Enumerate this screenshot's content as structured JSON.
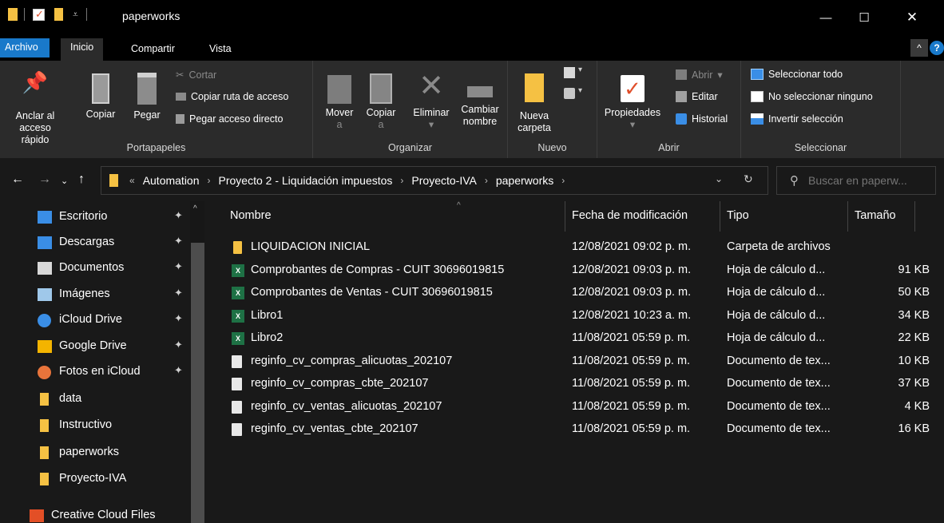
{
  "window": {
    "title": "paperworks",
    "minimize": "—",
    "maximize": "☐",
    "close": "✕"
  },
  "ribbon_tabs": [
    "Archivo",
    "Inicio",
    "Compartir",
    "Vista"
  ],
  "ribbon": {
    "portapapeles": {
      "name": "Portapapeles",
      "pin_line1": "Anclar al",
      "pin_line2": "acceso rápido",
      "copy": "Copiar",
      "paste": "Pegar",
      "cut": "Cortar",
      "copy_path": "Copiar ruta de acceso",
      "paste_shortcut": "Pegar acceso directo"
    },
    "organizar": {
      "name": "Organizar",
      "move_line1": "Mover",
      "move_line2": "a",
      "copy_line1": "Copiar",
      "copy_line2": "a",
      "delete": "Eliminar",
      "rename_line1": "Cambiar",
      "rename_line2": "nombre"
    },
    "nuevo": {
      "name": "Nuevo",
      "new_folder_line1": "Nueva",
      "new_folder_line2": "carpeta"
    },
    "abrir": {
      "name": "Abrir",
      "properties": "Propiedades",
      "open": "Abrir",
      "edit": "Editar",
      "history": "Historial"
    },
    "seleccionar": {
      "name": "Seleccionar",
      "select_all": "Seleccionar todo",
      "select_none": "No seleccionar ninguno",
      "invert": "Invertir selección"
    }
  },
  "address": {
    "overflow": "«",
    "crumbs": [
      "Automation",
      "Proyecto 2 - Liquidación impuestos",
      "Proyecto-IVA",
      "paperworks"
    ],
    "search_placeholder": "Buscar en paperw..."
  },
  "nav_items": [
    {
      "label": "Escritorio",
      "icon": "desktop-icon",
      "color": "#3a8ee6",
      "pinned": true
    },
    {
      "label": "Descargas",
      "icon": "download-icon",
      "color": "#3a8ee6",
      "pinned": true
    },
    {
      "label": "Documentos",
      "icon": "document-icon",
      "color": "#d8d8d8",
      "pinned": true
    },
    {
      "label": "Imágenes",
      "icon": "image-icon",
      "color": "#9fc8ea",
      "pinned": true
    },
    {
      "label": "iCloud Drive",
      "icon": "icloud-icon",
      "color": "#3a8ee6",
      "pinned": true
    },
    {
      "label": "Google Drive",
      "icon": "google-drive-icon",
      "color": "#f4b400",
      "pinned": true
    },
    {
      "label": "Fotos en iCloud",
      "icon": "photos-icon",
      "color": "#e8743b",
      "pinned": true
    },
    {
      "label": "data",
      "icon": "folder-icon",
      "color": "#f5c143",
      "pinned": false
    },
    {
      "label": "Instructivo",
      "icon": "folder-icon",
      "color": "#f5c143",
      "pinned": false
    },
    {
      "label": "paperworks",
      "icon": "folder-icon",
      "color": "#f5c143",
      "pinned": false
    },
    {
      "label": "Proyecto-IVA",
      "icon": "folder-icon",
      "color": "#f5c143",
      "pinned": false
    },
    {
      "label": "Creative Cloud Files",
      "icon": "creative-cloud-icon",
      "color": "#e34f26",
      "pinned": false
    }
  ],
  "columns": {
    "name": "Nombre",
    "modified": "Fecha de modificación",
    "type": "Tipo",
    "size": "Tamaño"
  },
  "files": [
    {
      "name": "LIQUIDACION INICIAL",
      "modified": "12/08/2021 09:02 p. m.",
      "type": "Carpeta de archivos",
      "size": "",
      "kind": "folder"
    },
    {
      "name": "Comprobantes de Compras - CUIT 30696019815",
      "modified": "12/08/2021 09:03 p. m.",
      "type": "Hoja de cálculo d...",
      "size": "91 KB",
      "kind": "excel"
    },
    {
      "name": "Comprobantes de Ventas - CUIT 30696019815",
      "modified": "12/08/2021 09:03 p. m.",
      "type": "Hoja de cálculo d...",
      "size": "50 KB",
      "kind": "excel"
    },
    {
      "name": "Libro1",
      "modified": "12/08/2021 10:23 a. m.",
      "type": "Hoja de cálculo d...",
      "size": "34 KB",
      "kind": "excel"
    },
    {
      "name": "Libro2",
      "modified": "11/08/2021 05:59 p. m.",
      "type": "Hoja de cálculo d...",
      "size": "22 KB",
      "kind": "excel"
    },
    {
      "name": "reginfo_cv_compras_alicuotas_202107",
      "modified": "11/08/2021 05:59 p. m.",
      "type": "Documento de tex...",
      "size": "10 KB",
      "kind": "text"
    },
    {
      "name": "reginfo_cv_compras_cbte_202107",
      "modified": "11/08/2021 05:59 p. m.",
      "type": "Documento de tex...",
      "size": "37 KB",
      "kind": "text"
    },
    {
      "name": "reginfo_cv_ventas_alicuotas_202107",
      "modified": "11/08/2021 05:59 p. m.",
      "type": "Documento de tex...",
      "size": "4 KB",
      "kind": "text"
    },
    {
      "name": "reginfo_cv_ventas_cbte_202107",
      "modified": "11/08/2021 05:59 p. m.",
      "type": "Documento de tex...",
      "size": "16 KB",
      "kind": "text"
    }
  ],
  "colors": {
    "accent": "#1979ca",
    "folder": "#f5c143",
    "excel": "#1e7145",
    "background": "#191919",
    "ribbon": "#2b2b2b"
  }
}
